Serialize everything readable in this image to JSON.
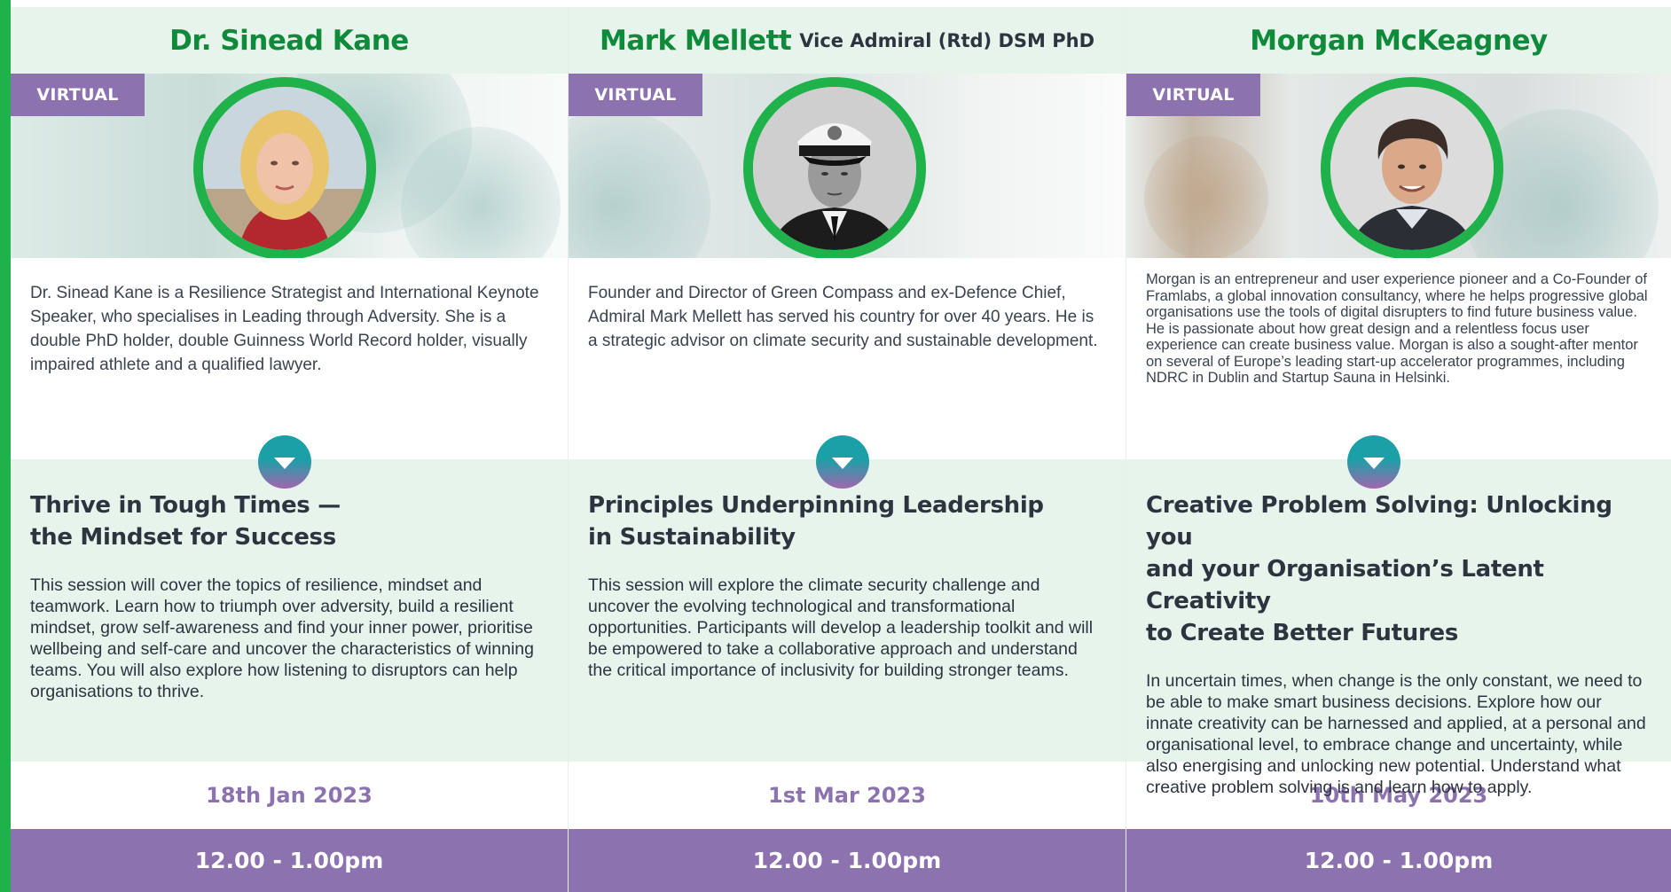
{
  "badge_label": "VIRTUAL",
  "colors": {
    "green": "#1fb24a",
    "purple": "#8c73b0",
    "mint": "#e6f4ec"
  },
  "speakers": [
    {
      "name": "Dr. Sinead Kane",
      "name_suffix": "",
      "bio": "Dr. Sinead Kane is a Resilience Strategist and International Keynote Speaker, who specialises in Leading through Adversity. She is a double PhD holder, double Guinness World Record holder, visually impaired athlete and a qualified lawyer.",
      "session_title": "Thrive in Tough Times —\nthe Mindset for Success",
      "session_description": "This session will cover the topics of resilience, mindset and teamwork. Learn how to triumph over adversity, build a resilient mindset, grow self-awareness and find your inner power, prioritise wellbeing and self-care and uncover the characteristics of winning teams. You will also explore how listening to disruptors can help organisations to thrive.",
      "date": "18th Jan 2023",
      "time": "12.00 - 1.00pm"
    },
    {
      "name": "Mark Mellett",
      "name_suffix": "Vice Admiral (Rtd) DSM PhD",
      "bio": "Founder and Director of Green Compass and ex-Defence Chief, Admiral Mark Mellett has served his country for over 40 years. He is a strategic advisor on climate security and sustainable development.",
      "session_title": "Principles Underpinning Leadership\nin Sustainability",
      "session_description": "This session will explore the climate security challenge and uncover the evolving technological and transformational opportunities. Participants will develop a leadership toolkit and will be empowered to take a collaborative approach and understand the critical importance of inclusivity for building stronger teams.",
      "date": "1st Mar 2023",
      "time": "12.00 - 1.00pm"
    },
    {
      "name": "Morgan McKeagney",
      "name_suffix": "",
      "bio": "Morgan is an entrepreneur and user experience pioneer and a Co-Founder of Framlabs, a global innovation consultancy, where he helps progressive global organisations use the tools of digital disrupters to find future business value. He is passionate about how great design and a relentless focus user experience can create business value. Morgan is also a sought-after mentor on several of Europe’s leading start-up accelerator programmes, including NDRC in Dublin and Startup Sauna in Helsinki.",
      "session_title": "Creative Problem Solving: Unlocking you\nand your Organisation’s Latent Creativity\nto Create Better Futures",
      "session_description": "In uncertain times, when change is the only constant, we need to be able to make smart business decisions. Explore how our innate creativity can be harnessed and applied, at a personal and organisational level, to embrace change and uncertainty, while also energising and unlocking new potential. Understand what creative problem solving is and learn how to apply.",
      "date": "10th May 2023",
      "time": "12.00 - 1.00pm"
    }
  ]
}
